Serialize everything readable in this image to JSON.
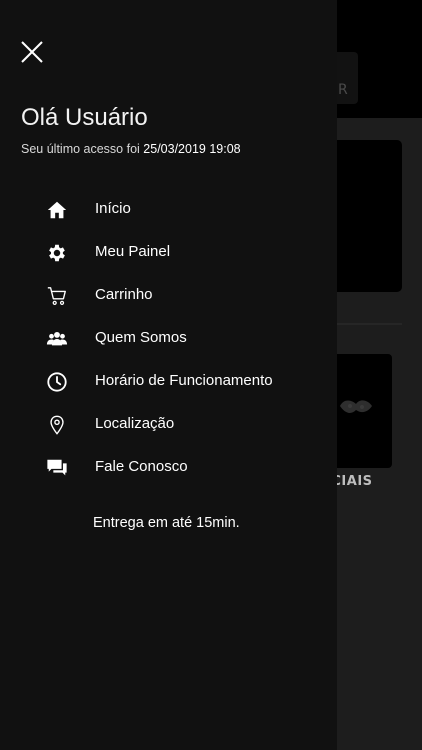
{
  "background": {
    "header_button_text": "R",
    "card_label": "ECIAIS"
  },
  "drawer": {
    "close_icon": "close-icon",
    "greeting": "Olá Usuário",
    "last_access_prefix": "Seu último acesso foi",
    "last_access_timestamp": "25/03/2019 19:08",
    "menu": [
      {
        "label": "Início",
        "icon": "home-icon"
      },
      {
        "label": "Meu Painel",
        "icon": "gear-icon"
      },
      {
        "label": "Carrinho",
        "icon": "cart-icon"
      },
      {
        "label": "Quem Somos",
        "icon": "people-icon"
      },
      {
        "label": "Horário de Funcionamento",
        "icon": "clock-icon"
      },
      {
        "label": "Localização",
        "icon": "location-pin-icon"
      },
      {
        "label": "Fale Conosco",
        "icon": "chat-icon"
      }
    ],
    "delivery_note": "Entrega em até 15min."
  },
  "colors": {
    "drawer_bg": "#111111",
    "text": "#ffffff",
    "overlay_bg": "#1b1b1b"
  }
}
